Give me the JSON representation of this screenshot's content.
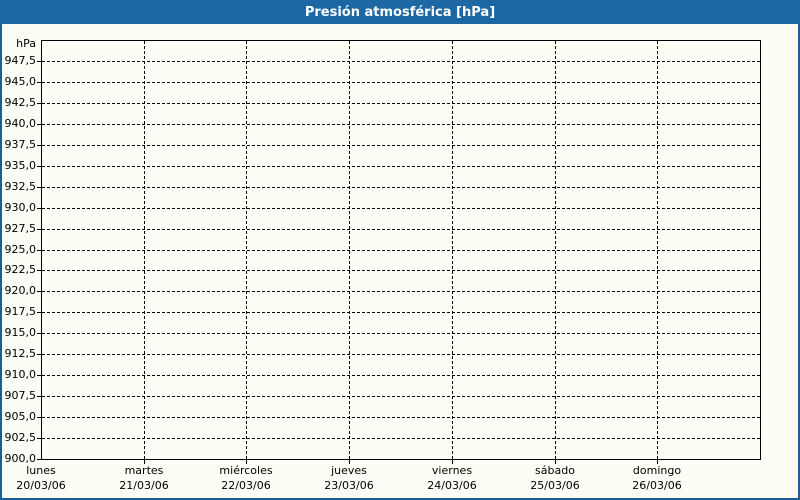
{
  "window": {
    "title": "Presión atmosférica [hPa]"
  },
  "colors": {
    "titlebar": "#1d68a4",
    "frame_border": "#1e5e8f",
    "content_bg": "#fcfdf5",
    "plot_bg": "#fcfdf5",
    "grid_line": "#000000",
    "axis_line": "#000000",
    "label_text": "#000000",
    "title_text": "#ffffff"
  },
  "chart_data": {
    "type": "line",
    "title": "Presión atmosférica [hPa]",
    "ylabel": "hPa",
    "ylim": [
      900,
      950
    ],
    "ytick_step": 2.5,
    "yticks": [
      {
        "value": 947.5,
        "label": "947,5"
      },
      {
        "value": 945.0,
        "label": "945,0"
      },
      {
        "value": 942.5,
        "label": "942,5"
      },
      {
        "value": 940.0,
        "label": "940,0"
      },
      {
        "value": 937.5,
        "label": "937,5"
      },
      {
        "value": 935.0,
        "label": "935,0"
      },
      {
        "value": 932.5,
        "label": "932,5"
      },
      {
        "value": 930.0,
        "label": "930,0"
      },
      {
        "value": 927.5,
        "label": "927,5"
      },
      {
        "value": 925.0,
        "label": "925,0"
      },
      {
        "value": 922.5,
        "label": "922,5"
      },
      {
        "value": 920.0,
        "label": "920,0"
      },
      {
        "value": 917.5,
        "label": "917,5"
      },
      {
        "value": 915.0,
        "label": "915,0"
      },
      {
        "value": 912.5,
        "label": "912,5"
      },
      {
        "value": 910.0,
        "label": "910,0"
      },
      {
        "value": 907.5,
        "label": "907,5"
      },
      {
        "value": 905.0,
        "label": "905,0"
      },
      {
        "value": 902.5,
        "label": "902,5"
      },
      {
        "value": 900.0,
        "label": "900,0"
      }
    ],
    "x_divisions": 7,
    "xticks": [
      {
        "day": "lunes",
        "date": "20/03/06"
      },
      {
        "day": "martes",
        "date": "21/03/06"
      },
      {
        "day": "miércoles",
        "date": "22/03/06"
      },
      {
        "day": "jueves",
        "date": "23/03/06"
      },
      {
        "day": "viernes",
        "date": "24/03/06"
      },
      {
        "day": "sábado",
        "date": "25/03/06"
      },
      {
        "day": "domingo",
        "date": "26/03/06"
      }
    ],
    "grid": true,
    "legend_position": "none",
    "series": []
  },
  "layout_note": "empty pressure chart, no data trace plotted"
}
